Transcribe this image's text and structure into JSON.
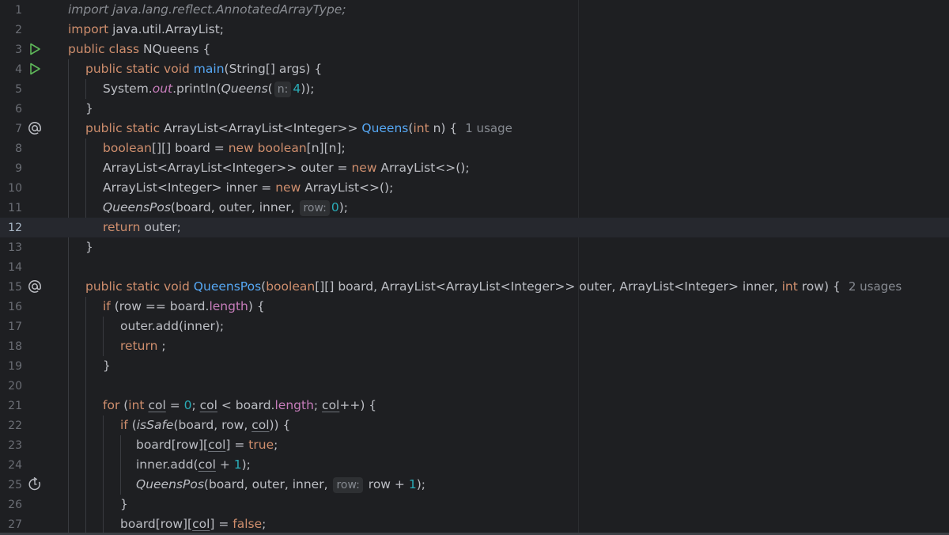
{
  "editor": {
    "language": "java",
    "current_line": 12,
    "lines": [
      {
        "n": "1"
      },
      {
        "n": "2"
      },
      {
        "n": "3"
      },
      {
        "n": "4"
      },
      {
        "n": "5"
      },
      {
        "n": "6"
      },
      {
        "n": "7"
      },
      {
        "n": "8"
      },
      {
        "n": "9"
      },
      {
        "n": "10"
      },
      {
        "n": "11"
      },
      {
        "n": "12"
      },
      {
        "n": "13"
      },
      {
        "n": "14"
      },
      {
        "n": "15"
      },
      {
        "n": "16"
      },
      {
        "n": "17"
      },
      {
        "n": "18"
      },
      {
        "n": "19"
      },
      {
        "n": "20"
      },
      {
        "n": "21"
      },
      {
        "n": "22"
      },
      {
        "n": "23"
      },
      {
        "n": "24"
      },
      {
        "n": "25"
      },
      {
        "n": "26"
      },
      {
        "n": "27"
      }
    ],
    "gutter_icons": {
      "3": "run-icon",
      "4": "run-icon",
      "7": "override-at-icon",
      "15": "override-at-icon",
      "25": "recursive-call-icon"
    },
    "code": {
      "l1_import": "import",
      "l1_rest": " java.lang.reflect.AnnotatedArrayType;",
      "l2_import": "import",
      "l2_rest": " java.util.ArrayList;",
      "l3_kw": "public class",
      "l3_rest": " NQueens {",
      "l4_kw": "public static void",
      "l4_fn": "main",
      "l4_rest": "(String[] args) {",
      "l5_a": "System.",
      "l5_field": "out",
      "l5_b": ".println(",
      "l5_call": "Queens",
      "l5_c": "(",
      "l5_hint": "n:",
      "l5_num": "4",
      "l5_d": "));",
      "l6": "}",
      "l7_kw": "public static",
      "l7_type": " ArrayList<ArrayList<Integer>> ",
      "l7_fn": "Queens",
      "l7_a": "(",
      "l7_int": "int",
      "l7_b": " n) {",
      "l7_usage": "1 usage",
      "l8_kw": "boolean",
      "l8_a": "[][] board = ",
      "l8_new": "new",
      "l8_kw2": " boolean",
      "l8_b": "[n][n];",
      "l9_a": "ArrayList<ArrayList<Integer>> outer = ",
      "l9_new": "new",
      "l9_b": " ArrayList<>();",
      "l10_a": "ArrayList<Integer> inner = ",
      "l10_new": "new",
      "l10_b": " ArrayList<>();",
      "l11_call": "QueensPos",
      "l11_a": "(board, outer, inner, ",
      "l11_hint": "row:",
      "l11_num": "0",
      "l11_b": ");",
      "l12_kw": "return",
      "l12_a": " outer;",
      "l13": "}",
      "l15_kw": "public static void",
      "l15_fn": "QueensPos",
      "l15_a": "(",
      "l15_bool": "boolean",
      "l15_b": "[][] board, ArrayList<ArrayList<Integer>> outer, ArrayList<Integer> inner, ",
      "l15_int": "int",
      "l15_c": " row) {",
      "l15_usage": "2 usages",
      "l16_kw": "if",
      "l16_a": " (row == board.",
      "l16_field": "length",
      "l16_b": ") {",
      "l17": "outer.add(inner);",
      "l18_kw": "return",
      "l18_a": " ;",
      "l19": "}",
      "l21_kw": "for",
      "l21_a": " (",
      "l21_int": "int",
      "l21_sp": " ",
      "l21_col1": "col",
      "l21_b": " = ",
      "l21_num": "0",
      "l21_c": "; ",
      "l21_col2": "col",
      "l21_d": " < board.",
      "l21_field": "length",
      "l21_e": "; ",
      "l21_col3": "col",
      "l21_f": "++) {",
      "l22_kw": "if",
      "l22_a": " (",
      "l22_call": "isSafe",
      "l22_b": "(board, row, ",
      "l22_col": "col",
      "l22_c": ")) {",
      "l23_a": "board[row][",
      "l23_col": "col",
      "l23_b": "] = ",
      "l23_kw": "true",
      "l23_c": ";",
      "l24_a": "inner.add(",
      "l24_col": "col",
      "l24_b": " + ",
      "l24_num": "1",
      "l24_c": ");",
      "l25_call": "QueensPos",
      "l25_a": "(board, outer, inner, ",
      "l25_hint": "row:",
      "l25_b": " row + ",
      "l25_num": "1",
      "l25_c": ");",
      "l26": "}",
      "l27_a": "board[row][",
      "l27_col": "col",
      "l27_b": "] = ",
      "l27_kw": "false",
      "l27_c": ";"
    },
    "colors": {
      "background": "#1e1f22",
      "keyword": "#cf8e6d",
      "function": "#56a8f5",
      "number": "#2aacb8",
      "field": "#c77dbb",
      "text": "#bcbec4",
      "run_icon": "#5fb85a"
    }
  }
}
